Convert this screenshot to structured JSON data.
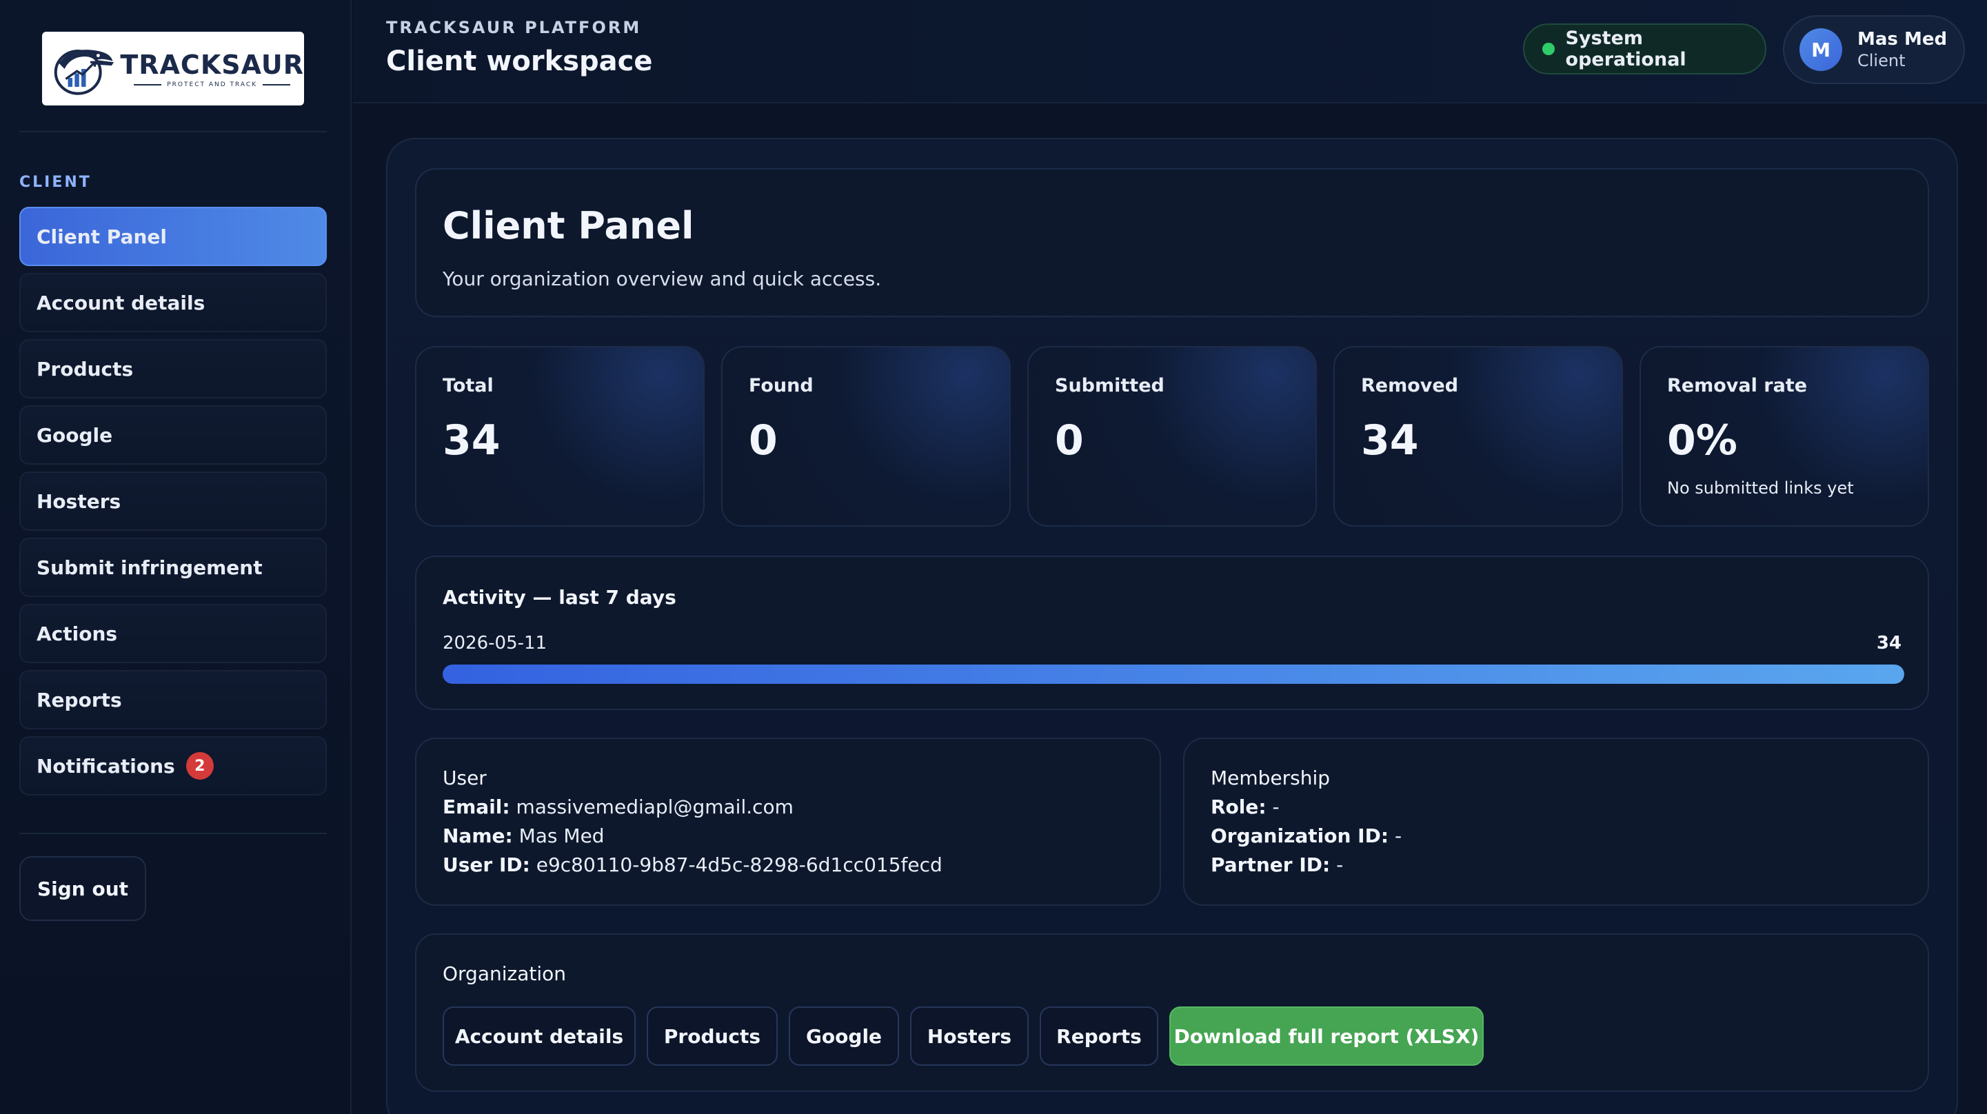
{
  "brand": {
    "logo_word": "TRACKSAUR",
    "logo_tagline": "PROTECT AND TRACK"
  },
  "sidebar": {
    "section_label": "CLIENT",
    "items": [
      {
        "label": "Client Panel",
        "active": true
      },
      {
        "label": "Account details"
      },
      {
        "label": "Products"
      },
      {
        "label": "Google"
      },
      {
        "label": "Hosters"
      },
      {
        "label": "Submit infringement"
      },
      {
        "label": "Actions"
      },
      {
        "label": "Reports"
      },
      {
        "label": "Notifications",
        "badge": "2"
      }
    ],
    "signout_label": "Sign out"
  },
  "header": {
    "eyebrow": "TRACKSAUR PLATFORM",
    "title": "Client workspace",
    "status": "System operational",
    "user": {
      "initial": "M",
      "name": "Mas Med",
      "role": "Client"
    }
  },
  "hero": {
    "title": "Client Panel",
    "subtitle": "Your organization overview and quick access."
  },
  "stats": [
    {
      "label": "Total",
      "value": "34"
    },
    {
      "label": "Found",
      "value": "0"
    },
    {
      "label": "Submitted",
      "value": "0"
    },
    {
      "label": "Removed",
      "value": "34"
    },
    {
      "label": "Removal rate",
      "value": "0%",
      "note": "No submitted links yet"
    }
  ],
  "activity": {
    "title": "Activity — last 7 days",
    "rows": [
      {
        "date": "2026-05-11",
        "count": "34",
        "fill_fraction": 1.0
      }
    ]
  },
  "user_card": {
    "heading": "User",
    "email_label": "Email:",
    "email": "massivemediapl@gmail.com",
    "name_label": "Name:",
    "name": "Mas Med",
    "id_label": "User ID:",
    "id": "e9c80110-9b87-4d5c-8298-6d1cc015fecd"
  },
  "membership_card": {
    "heading": "Membership",
    "role_label": "Role:",
    "role": "-",
    "org_label": "Organization ID:",
    "org": "-",
    "partner_label": "Partner ID:",
    "partner": "-"
  },
  "organization": {
    "title": "Organization",
    "buttons": [
      "Account details",
      "Products",
      "Google",
      "Hosters",
      "Reports"
    ],
    "download_label": "Download full report (XLSX)"
  },
  "colors": {
    "accent": "#3b66d9",
    "status_ok": "#2fcc6a",
    "badge": "#d43a3a",
    "download": "#46a553"
  }
}
